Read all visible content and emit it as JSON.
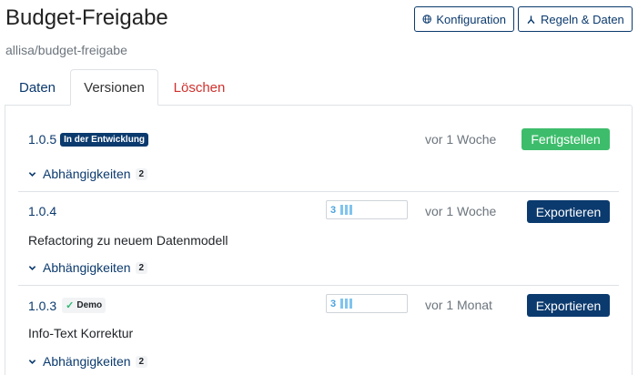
{
  "header": {
    "title": "Budget-Freigabe",
    "subtitle": "allisa/budget-freigabe",
    "config_button": "Konfiguration",
    "rules_button": "Regeln & Daten"
  },
  "tabs": [
    {
      "label": "Daten"
    },
    {
      "label": "Versionen",
      "active": true
    },
    {
      "label": "Löschen"
    }
  ],
  "versions": [
    {
      "version": "1.0.5",
      "badge": "In der Entwicklung",
      "time": "vor 1 Woche",
      "action": "Fertigstellen",
      "deps_label": "Abhängigkeiten",
      "deps_count": "2"
    },
    {
      "version": "1.0.4",
      "count": "3",
      "time": "vor 1 Woche",
      "action": "Exportieren",
      "description": "Refactoring zu neuem Datenmodell",
      "deps_label": "Abhängigkeiten",
      "deps_count": "2"
    },
    {
      "version": "1.0.3",
      "badge": "Demo",
      "count": "3",
      "time": "vor 1 Monat",
      "action": "Exportieren",
      "description": "Info-Text Korrektur",
      "deps_label": "Abhängigkeiten",
      "deps_count": "2"
    }
  ],
  "colors": {
    "primary": "#0b3a6e",
    "success": "#3dbd6b",
    "danger": "#d0312d",
    "muted": "#6c757d"
  }
}
